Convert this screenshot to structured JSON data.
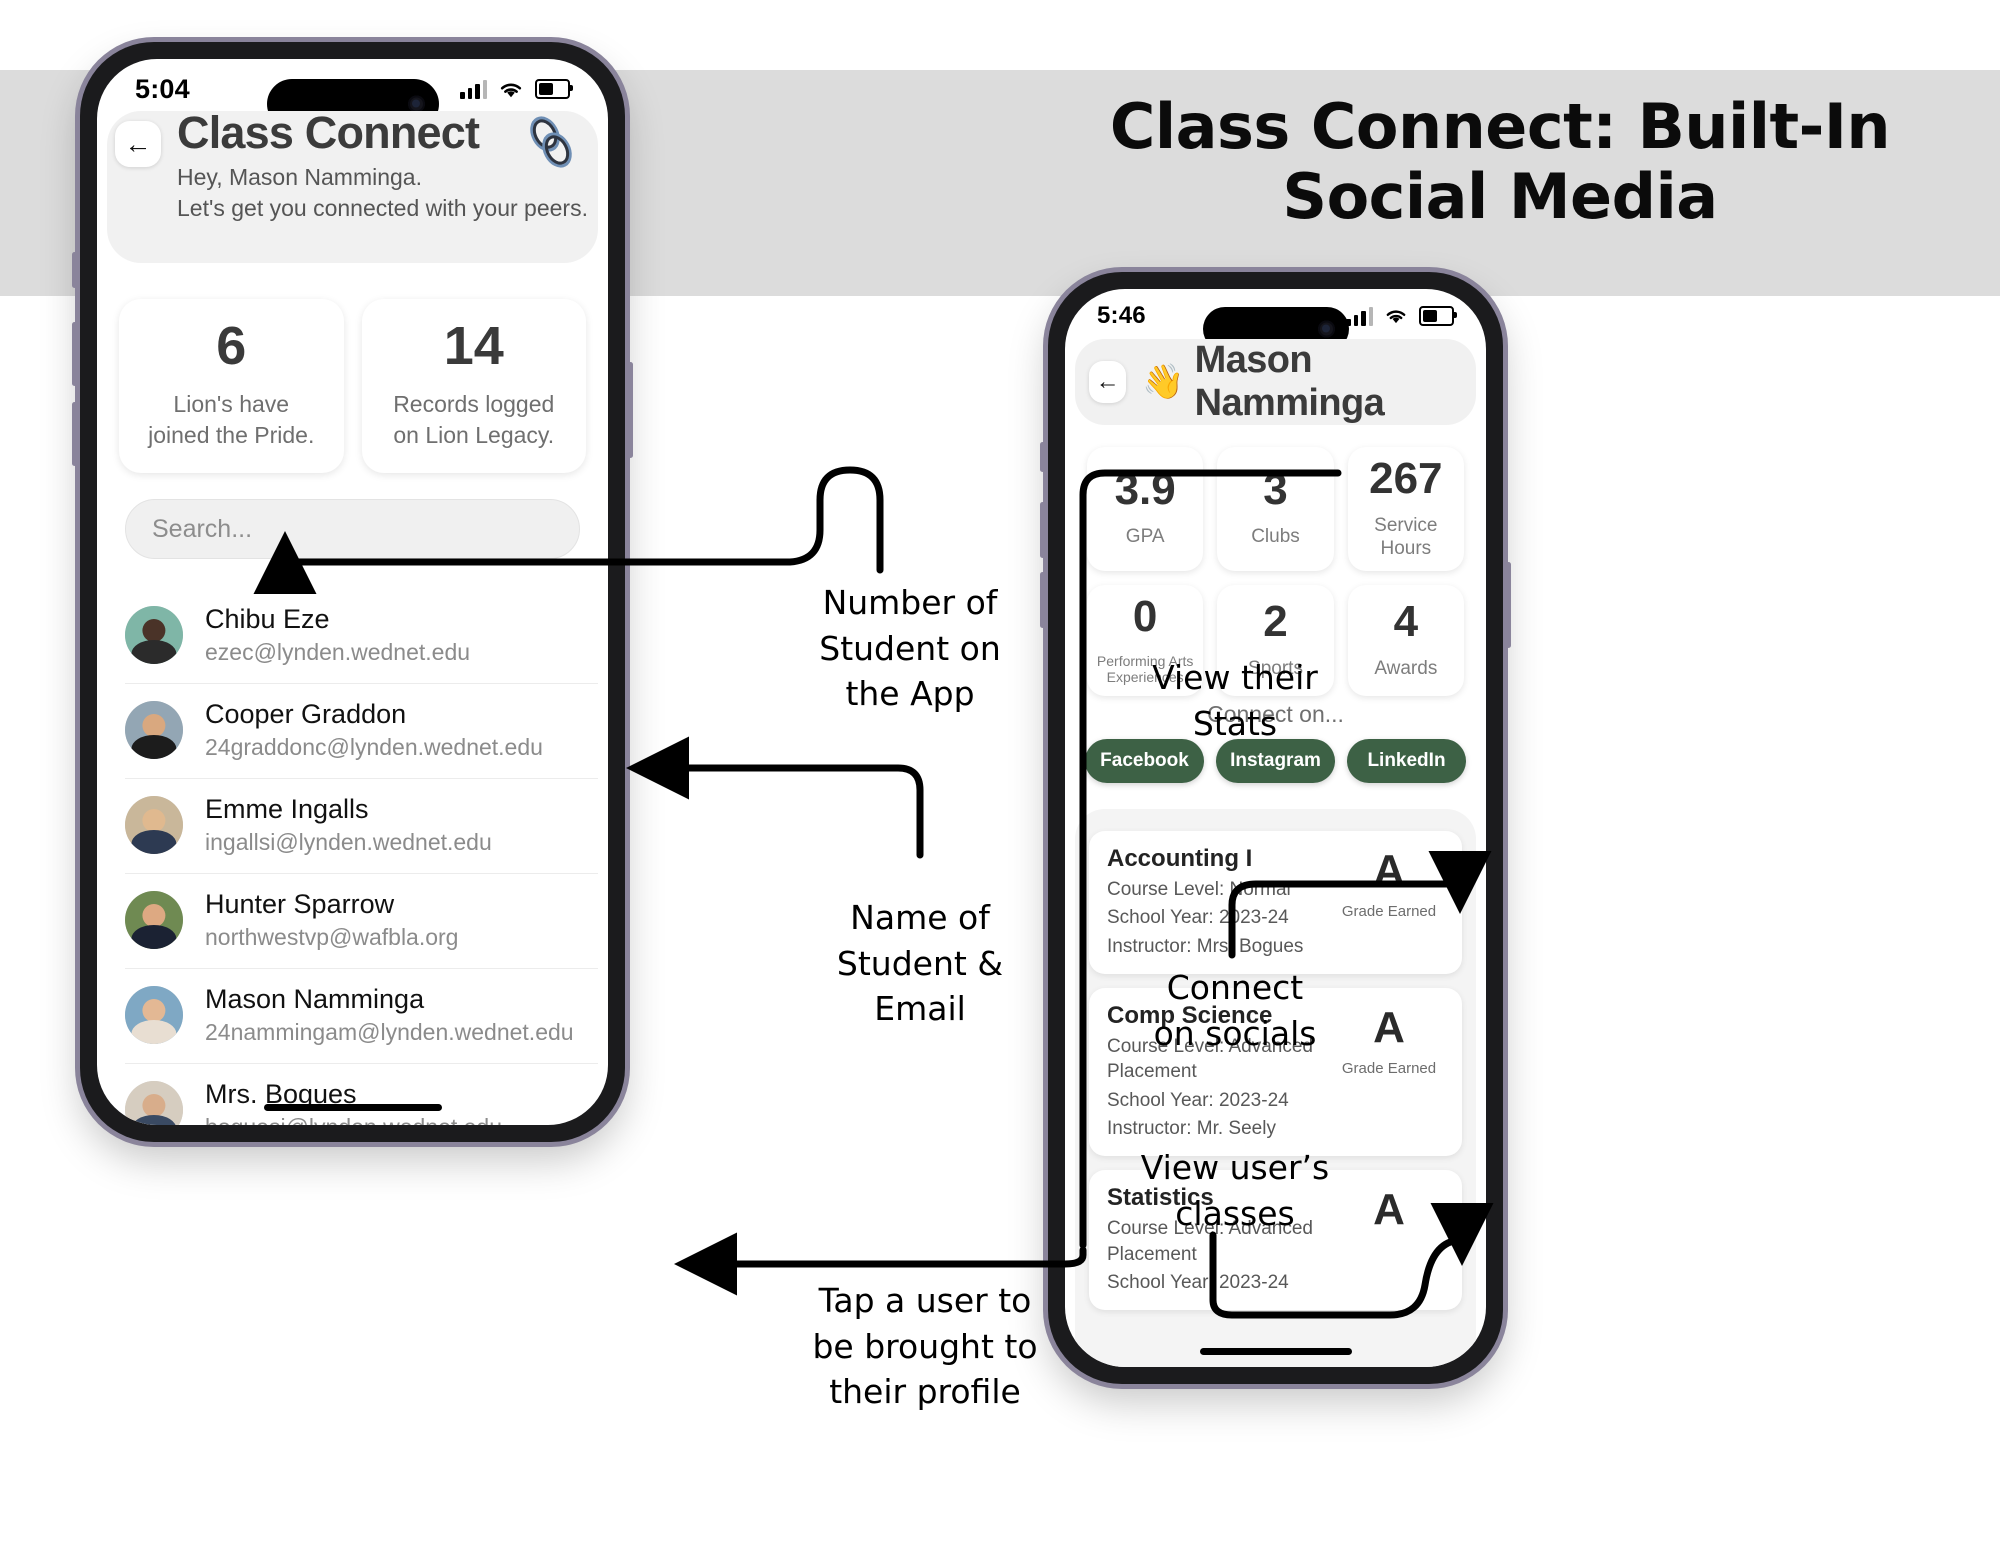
{
  "banner": {
    "title_line1": "Class Connect: Built-In",
    "title_line2": "Social Media",
    "bg_color": "#dcdcdc"
  },
  "left_phone": {
    "status": {
      "time": "5:04",
      "signal_icon": "cellular-bars-icon",
      "wifi_icon": "wifi-icon",
      "battery_icon": "battery-icon"
    },
    "header": {
      "back_icon": "←",
      "title": "Class Connect",
      "greeting_line1": "Hey, Mason Namminga.",
      "greeting_line2": "Let's get you connected with your peers.",
      "link_icon": "chain-link-icon"
    },
    "stats": [
      {
        "number": "6",
        "label_line1": "Lion's have",
        "label_line2": "joined the Pride."
      },
      {
        "number": "14",
        "label_line1": "Records logged",
        "label_line2": "on Lion Legacy."
      }
    ],
    "search": {
      "placeholder": "Search...",
      "value": ""
    },
    "people": [
      {
        "name": "Chibu Eze",
        "email": "ezec@lynden.wednet.edu",
        "bg": "#7fb6a7",
        "skin": "#4a3328",
        "shirt": "#2b2b2b"
      },
      {
        "name": "Cooper Graddon",
        "email": "24graddonc@lynden.wednet.edu",
        "bg": "#93a6b4",
        "skin": "#d9a87f",
        "shirt": "#1c1c1c"
      },
      {
        "name": "Emme Ingalls",
        "email": "ingallsi@lynden.wednet.edu",
        "bg": "#c9b79a",
        "skin": "#e0b98f",
        "shirt": "#2d3a52"
      },
      {
        "name": "Hunter Sparrow",
        "email": "northwestvp@wafbla.org",
        "bg": "#6f8a52",
        "skin": "#dda982",
        "shirt": "#1b2233"
      },
      {
        "name": "Mason Namminga",
        "email": "24nammingam@lynden.wednet.edu",
        "bg": "#7fa8c4",
        "skin": "#e3b894",
        "shirt": "#e8ded2"
      },
      {
        "name": "Mrs. Bogues",
        "email": "boguesj@lynden.wednet.edu",
        "bg": "#d6cdc0",
        "skin": "#d8ad8b",
        "shirt": "#3a4a63"
      }
    ]
  },
  "right_phone": {
    "status": {
      "time": "5:46",
      "signal_icon": "cellular-bars-icon",
      "wifi_icon": "wifi-icon",
      "battery_icon": "battery-icon"
    },
    "header": {
      "back_icon": "←",
      "wave_emoji": "👋",
      "name": "Mason Namminga"
    },
    "stats": [
      {
        "number": "3.9",
        "label": "GPA",
        "small": false
      },
      {
        "number": "3",
        "label": "Clubs",
        "small": false
      },
      {
        "number": "267",
        "label": "Service Hours",
        "small": false
      },
      {
        "number": "0",
        "label": "Performing Arts Experiences",
        "small": true
      },
      {
        "number": "2",
        "label": "Sports",
        "small": false
      },
      {
        "number": "4",
        "label": "Awards",
        "small": false
      }
    ],
    "connect_label": "Connect on...",
    "socials": [
      {
        "label": "Facebook",
        "color": "#3d6145"
      },
      {
        "label": "Instagram",
        "color": "#3d6145"
      },
      {
        "label": "LinkedIn",
        "color": "#3d6145"
      }
    ],
    "classes": [
      {
        "title": "Accounting I",
        "level": "Course Level: Normal",
        "year": "School Year: 2023-24",
        "instructor": "Instructor: Mrs. Bogues",
        "grade": "A",
        "grade_label": "Grade Earned"
      },
      {
        "title": "Comp Science",
        "level": "Course Level: Advanced Placement",
        "year": "School Year: 2023-24",
        "instructor": "Instructor: Mr. Seely",
        "grade": "A",
        "grade_label": "Grade Earned"
      },
      {
        "title": "Statistics",
        "level": "Course Level: Advanced Placement",
        "year": "School Year: 2023-24",
        "instructor": "",
        "grade": "A",
        "grade_label": ""
      }
    ]
  },
  "annotations": [
    {
      "id": "num-students",
      "line1": "Number of",
      "line2": "Student on",
      "line3": "the App"
    },
    {
      "id": "name-email",
      "line1": "Name of",
      "line2": "Student &",
      "line3": "Email"
    },
    {
      "id": "tap-user",
      "line1": "Tap a user to",
      "line2": "be brought to",
      "line3": "their profile"
    },
    {
      "id": "view-stats",
      "line1": "View their",
      "line2": "Stats",
      "line3": ""
    },
    {
      "id": "connect-socials",
      "line1": "Connect",
      "line2": "on socials",
      "line3": ""
    },
    {
      "id": "view-classes",
      "line1": "View user’s",
      "line2": "classes",
      "line3": ""
    }
  ]
}
